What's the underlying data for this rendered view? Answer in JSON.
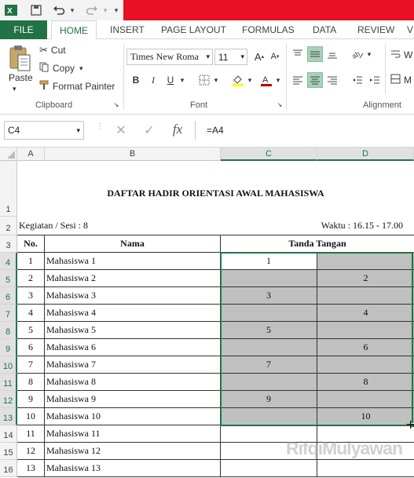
{
  "quick_access": {
    "excel_icon": "excel-icon",
    "save_icon": "save-icon",
    "undo_icon": "undo-icon",
    "redo_icon": "redo-icon"
  },
  "tabs": {
    "file": "FILE",
    "items": [
      {
        "label": "HOME",
        "active": true
      },
      {
        "label": "INSERT"
      },
      {
        "label": "PAGE LAYOUT"
      },
      {
        "label": "FORMULAS"
      },
      {
        "label": "DATA"
      },
      {
        "label": "REVIEW"
      },
      {
        "label": "V"
      }
    ]
  },
  "ribbon": {
    "clipboard": {
      "paste": "Paste",
      "cut": "Cut",
      "copy": "Copy",
      "format_painter": "Format Painter",
      "label": "Clipboard"
    },
    "font": {
      "font_name": "Times New Roma",
      "font_size": "11",
      "bold": "B",
      "italic": "I",
      "underline": "U",
      "label": "Font",
      "fill_color": "#ffff00",
      "font_color": "#c00000"
    },
    "alignment": {
      "label": "Alignment",
      "wrap": "W",
      "merge": "M"
    }
  },
  "formula_bar": {
    "name_box": "C4",
    "cancel": "✕",
    "enter": "✓",
    "fx": "fx",
    "formula": "=A4"
  },
  "columns": [
    {
      "name": "A",
      "selected": false
    },
    {
      "name": "B",
      "selected": false
    },
    {
      "name": "C",
      "selected": true
    },
    {
      "name": "D",
      "selected": true
    }
  ],
  "sheet": {
    "title": "DAFTAR HADIR ORIENTASI AWAL MAHASISWA",
    "kegiatan": "Kegiatan / Sesi : 8",
    "waktu": "Waktu : 16.15 - 17.00",
    "header_no": "No.",
    "header_nama": "Nama",
    "header_tanda": "Tanda Tangan",
    "rows": [
      {
        "row": "4",
        "no": "1",
        "nama": "Mahasiswa 1",
        "c": "1",
        "d": ""
      },
      {
        "row": "5",
        "no": "2",
        "nama": "Mahasiswa 2",
        "c": "",
        "d": "2"
      },
      {
        "row": "6",
        "no": "3",
        "nama": "Mahasiswa 3",
        "c": "3",
        "d": ""
      },
      {
        "row": "7",
        "no": "4",
        "nama": "Mahasiswa 4",
        "c": "",
        "d": "4"
      },
      {
        "row": "8",
        "no": "5",
        "nama": "Mahasiswa 5",
        "c": "5",
        "d": ""
      },
      {
        "row": "9",
        "no": "6",
        "nama": "Mahasiswa 6",
        "c": "",
        "d": "6"
      },
      {
        "row": "10",
        "no": "7",
        "nama": "Mahasiswa 7",
        "c": "7",
        "d": ""
      },
      {
        "row": "11",
        "no": "8",
        "nama": "Mahasiswa 8",
        "c": "",
        "d": "8"
      },
      {
        "row": "12",
        "no": "9",
        "nama": "Mahasiswa 9",
        "c": "9",
        "d": ""
      },
      {
        "row": "13",
        "no": "10",
        "nama": "Mahasiswa 10",
        "c": "",
        "d": "10"
      },
      {
        "row": "14",
        "no": "11",
        "nama": "Mahasiswa 11",
        "c": "",
        "d": ""
      },
      {
        "row": "15",
        "no": "12",
        "nama": "Mahasiswa 12",
        "c": "",
        "d": ""
      },
      {
        "row": "16",
        "no": "13",
        "nama": "Mahasiswa 13",
        "c": "",
        "d": ""
      }
    ],
    "row_labels_top": [
      "1",
      "2",
      "3"
    ]
  },
  "watermark": "RifqiMulyawan",
  "colors": {
    "excel_green": "#217346",
    "title_red": "#e81123",
    "shade_gray": "#c0c0c0"
  }
}
